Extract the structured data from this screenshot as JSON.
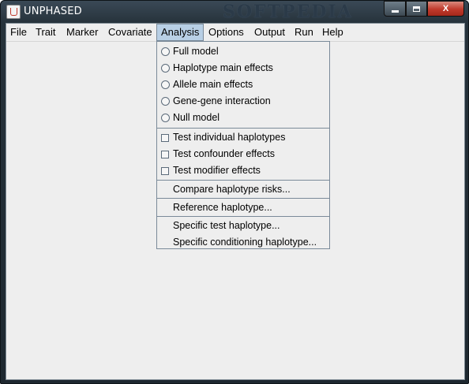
{
  "window": {
    "title": "UNPHASED",
    "watermark": "SOFTPEDIA",
    "close_label": "X"
  },
  "menubar": {
    "items": [
      {
        "label": "File"
      },
      {
        "label": "Trait"
      },
      {
        "label": "Marker"
      },
      {
        "label": "Covariate"
      },
      {
        "label": "Analysis"
      },
      {
        "label": "Options"
      },
      {
        "label": "Output"
      },
      {
        "label": "Run"
      },
      {
        "label": "Help"
      }
    ],
    "active": "Analysis"
  },
  "analysis_menu": {
    "radio_items": [
      {
        "label": "Full model"
      },
      {
        "label": "Haplotype main effects"
      },
      {
        "label": "Allele main effects"
      },
      {
        "label": "Gene-gene interaction"
      },
      {
        "label": "Null model"
      }
    ],
    "check_items": [
      {
        "label": "Test individual haplotypes"
      },
      {
        "label": "Test confounder effects"
      },
      {
        "label": "Test modifier effects"
      }
    ],
    "actions": [
      {
        "label": "Compare haplotype risks..."
      },
      {
        "label": "Reference haplotype..."
      },
      {
        "label": "Specific test haplotype..."
      },
      {
        "label": "Specific conditioning haplotype..."
      }
    ]
  },
  "colors": {
    "menu_highlight": "#b8cfe5",
    "menu_border": "#7a8a99",
    "client_bg": "#eeeeee",
    "frame": "#26323b",
    "close_button": "#c0392b"
  }
}
